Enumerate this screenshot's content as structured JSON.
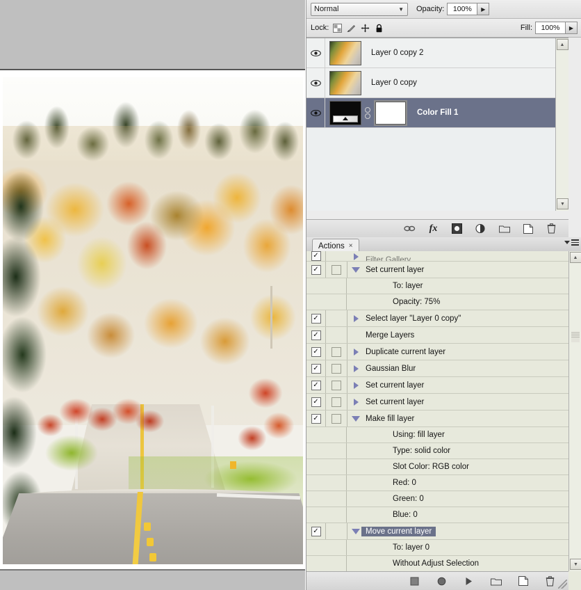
{
  "document": {
    "photo_alt": "autumn-forest-road-photograph"
  },
  "layers_panel": {
    "blend_mode": "Normal",
    "blend_mode_options": [
      "Normal"
    ],
    "opacity_label": "Opacity:",
    "opacity_value": "100%",
    "lock_label": "Lock:",
    "fill_label": "Fill:",
    "fill_value": "100%",
    "lock_icons": [
      "lock-transparent-pixels-icon",
      "lock-image-pixels-icon",
      "lock-position-icon",
      "lock-all-icon"
    ],
    "layers": [
      {
        "name": "Layer 0 copy 2",
        "visible": true,
        "selected": false,
        "kind": "pixel"
      },
      {
        "name": "Layer 0 copy",
        "visible": true,
        "selected": false,
        "kind": "pixel"
      },
      {
        "name": "Color Fill 1",
        "visible": true,
        "selected": true,
        "kind": "fill"
      }
    ],
    "footer_buttons": [
      {
        "name": "link-layers-button",
        "glyph": "link-icon"
      },
      {
        "name": "layer-style-button",
        "glyph": "fx-icon"
      },
      {
        "name": "add-layer-mask-button",
        "glyph": "mask-icon"
      },
      {
        "name": "new-adjustment-layer-button",
        "glyph": "half-circle-icon"
      },
      {
        "name": "new-group-button",
        "glyph": "folder-icon"
      },
      {
        "name": "new-layer-button",
        "glyph": "new-page-icon"
      },
      {
        "name": "delete-layer-button",
        "glyph": "trash-icon"
      }
    ]
  },
  "actions_panel": {
    "tab_label": "Actions",
    "tab_close": "×",
    "rows": [
      {
        "type": "step",
        "label": "Filter Gallery",
        "checked": true,
        "dialog": false,
        "expanded": false,
        "clipped": true
      },
      {
        "type": "step",
        "label": "Set current layer",
        "checked": true,
        "dialog": false,
        "expanded": true
      },
      {
        "type": "detail",
        "label": "To: layer"
      },
      {
        "type": "detail",
        "label": "Opacity: 75%"
      },
      {
        "type": "step",
        "label": "Select layer \"Layer 0 copy\"",
        "checked": true,
        "dialog": false,
        "expanded": false
      },
      {
        "type": "step",
        "label": "Merge Layers",
        "checked": true,
        "dialog": false,
        "expanded": null
      },
      {
        "type": "step",
        "label": "Duplicate current layer",
        "checked": true,
        "dialog": false,
        "expanded": false
      },
      {
        "type": "step",
        "label": "Gaussian Blur",
        "checked": true,
        "dialog": false,
        "expanded": false
      },
      {
        "type": "step",
        "label": "Set current layer",
        "checked": true,
        "dialog": false,
        "expanded": false
      },
      {
        "type": "step",
        "label": "Set current layer",
        "checked": true,
        "dialog": false,
        "expanded": false
      },
      {
        "type": "step",
        "label": "Make fill layer",
        "checked": true,
        "dialog": false,
        "expanded": true
      },
      {
        "type": "detail",
        "label": "Using: fill layer"
      },
      {
        "type": "detail",
        "label": "Type: solid color"
      },
      {
        "type": "detail",
        "label": "Slot Color: RGB color"
      },
      {
        "type": "detail",
        "label": "Red: 0"
      },
      {
        "type": "detail",
        "label": "Green: 0"
      },
      {
        "type": "detail",
        "label": "Blue: 0"
      },
      {
        "type": "step",
        "label": "Move current layer",
        "checked": true,
        "dialog": false,
        "expanded": true,
        "selected": true
      },
      {
        "type": "detail",
        "label": "To: layer 0"
      },
      {
        "type": "detail",
        "label": "Without Adjust Selection"
      }
    ],
    "footer_buttons": [
      {
        "name": "stop-button",
        "glyph": "stop-icon"
      },
      {
        "name": "record-button",
        "glyph": "record-icon"
      },
      {
        "name": "play-button",
        "glyph": "play-icon"
      },
      {
        "name": "new-set-button",
        "glyph": "folder-icon"
      },
      {
        "name": "new-action-button",
        "glyph": "new-page-icon"
      },
      {
        "name": "delete-action-button",
        "glyph": "trash-icon"
      }
    ]
  },
  "colors": {
    "selection": "#6b728a",
    "actions_bg": "#e7e9dc",
    "layers_bg": "#eceff0",
    "canvas_gray": "#bfbfbf"
  }
}
